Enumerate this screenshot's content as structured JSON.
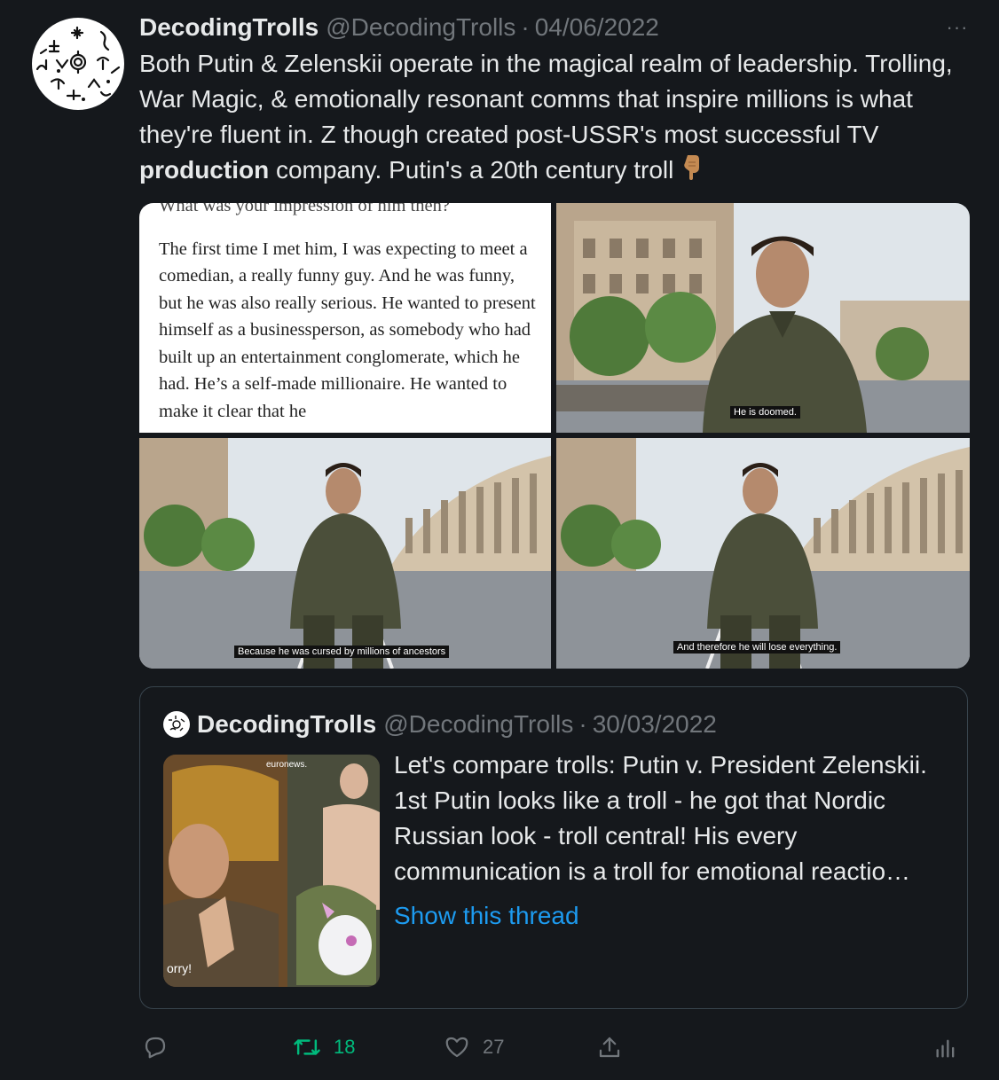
{
  "tweet": {
    "display_name": "DecodingTrolls",
    "handle": "@DecodingTrolls",
    "separator": "·",
    "date": "04/06/2022",
    "more_label": "···",
    "text_before_bold": "Both Putin & Zelenskii operate in the magical realm of leadership. Trolling, War Magic, & emotionally resonant comms that inspire millions is what they're fluent in. Z though created post-USSR's most successful TV ",
    "text_bold": "production",
    "text_after_bold": " company. Putin's a 20th century troll",
    "emoji_icon": "pointing-down-hand-icon"
  },
  "media": {
    "book_page": {
      "cut_line": "What was your impression of him then?",
      "paragraph": "The first time I met him, I was expecting to meet a comedian, a really funny guy. And he was funny, but he was also really serious. He wanted to present himself as a businessperson, as somebody who had built up an entertainment conglomerate, which he had. He’s a self-made millionaire. He wanted to make it clear that he"
    },
    "captions": [
      "He is doomed.",
      "Because he was cursed by millions of ancestors",
      "And therefore he will lose everything."
    ]
  },
  "quoted_tweet": {
    "display_name": "DecodingTrolls",
    "handle": "@DecodingTrolls",
    "separator": "·",
    "date": "30/03/2022",
    "thumb_brand": "euronews.",
    "thumb_caption": "orry!",
    "text": "Let's compare trolls: Putin v. President Zelenskii. 1st Putin looks like a troll - he got that Nordic Russian look - troll central! His every communication is a troll for emotional reactio…",
    "show_thread_label": "Show this thread"
  },
  "actions": {
    "reply_icon": "reply-icon",
    "retweet_count": "18",
    "like_count": "27",
    "share_icon": "share-icon",
    "analytics_icon": "analytics-icon"
  },
  "colors": {
    "background": "#15181c",
    "text": "#e7e9ea",
    "muted": "#71767b",
    "link": "#1d9bf0",
    "retweet": "#00ba7c",
    "border": "#38444d"
  }
}
